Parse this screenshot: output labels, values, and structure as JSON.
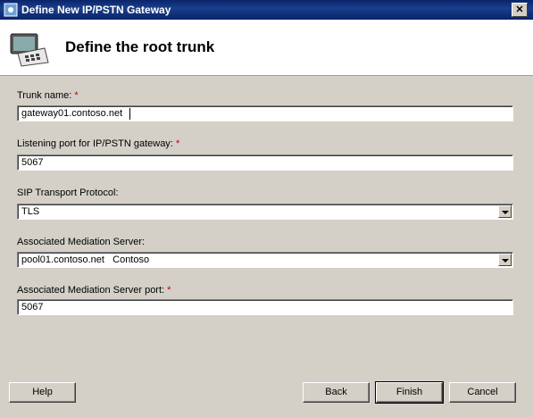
{
  "window": {
    "title": "Define New IP/PSTN Gateway",
    "close_glyph": "✕"
  },
  "header": {
    "title": "Define the root trunk",
    "icon": "phone-gateway-icon"
  },
  "fields": {
    "trunk_name": {
      "label": "Trunk name:",
      "required": "*",
      "value": "gateway01.contoso.net"
    },
    "listening_port": {
      "label": "Listening port for IP/PSTN gateway:",
      "required": "*",
      "value": "5067"
    },
    "sip_transport": {
      "label": "SIP Transport Protocol:",
      "value": "TLS"
    },
    "mediation_server": {
      "label": "Associated Mediation Server:",
      "value": "pool01.contoso.net   Contoso"
    },
    "mediation_port": {
      "label": "Associated Mediation Server port:",
      "required": "*",
      "value": "5067"
    }
  },
  "buttons": {
    "help": "Help",
    "back": "Back",
    "finish": "Finish",
    "cancel": "Cancel"
  }
}
